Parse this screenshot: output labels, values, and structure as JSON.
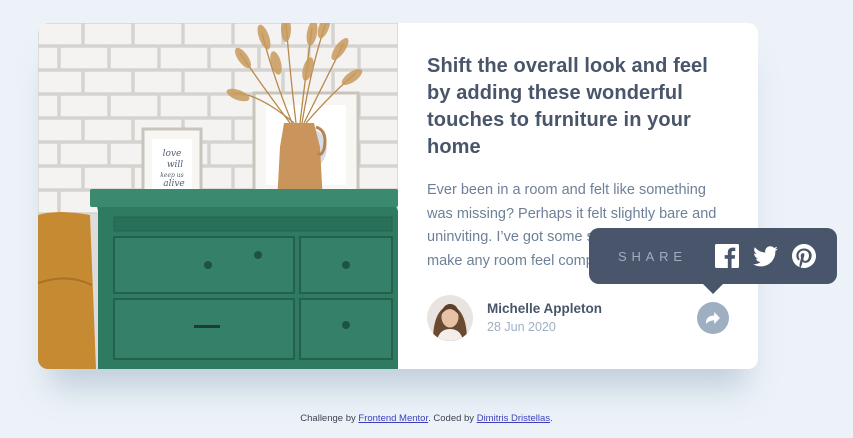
{
  "article": {
    "title": "Shift the overall look and feel by adding these wonderful touches to furniture in your home",
    "description": "Ever been in a room and felt like something was missing? Perhaps it felt slightly bare and uninviting. I’ve got some simple tips to help you make any room feel complete.",
    "author_name": "Michelle Appleton",
    "date": "28 Jun 2020"
  },
  "share": {
    "label": "SHARE",
    "icons": [
      "facebook-icon",
      "twitter-icon",
      "pinterest-icon"
    ]
  },
  "footer": {
    "prefix": "Challenge by ",
    "link1": "Frontend Mentor",
    "middle": ". Coded by ",
    "link2": "Dimitris Dristellas",
    "suffix": "."
  },
  "colors": {
    "background": "#ecf2f8",
    "dark_blue": "#48556a",
    "grayish_blue": "#6e8098",
    "light_grayish_blue": "#9eafc2"
  }
}
